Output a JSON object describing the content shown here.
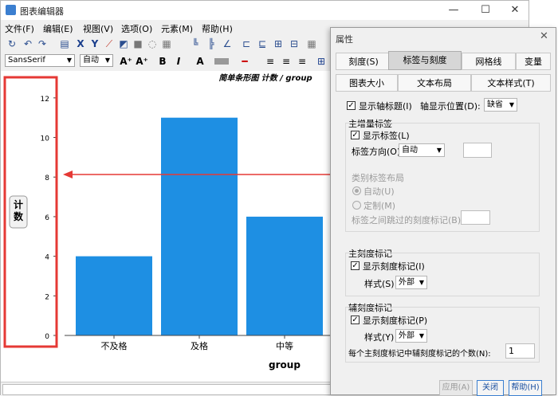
{
  "window": {
    "title": "图表编辑器",
    "minimize": "—",
    "maximize": "☐",
    "close": "✕"
  },
  "menu": [
    "文件(F)",
    "编辑(E)",
    "视图(V)",
    "选项(O)",
    "元素(M)",
    "帮助(H)"
  ],
  "format_bar": {
    "font": "SansSerif",
    "size": "自动",
    "bold": "B",
    "italic": "I"
  },
  "chart_data": {
    "type": "bar",
    "title": "简单条形图 计数 / group",
    "categories": [
      "不及格",
      "及格",
      "中等"
    ],
    "values": [
      4,
      11,
      6
    ],
    "xlabel": "group",
    "ylabel": "计数",
    "ylim": [
      0,
      13
    ],
    "yticks": [
      0,
      2,
      4,
      6,
      8,
      10,
      12
    ],
    "color": "#1e8fe3",
    "grid": false,
    "annotation_color": "#e53935"
  },
  "dialog": {
    "title": "属性",
    "close": "✕",
    "tabs": [
      "刻度(S)",
      "标签与刻度",
      "网格线",
      "变量",
      "图表大小",
      "文本布局",
      "文本样式(T)"
    ],
    "show_axis_title": "显示轴标题(I)",
    "axis_position_label": "轴显示位置(D):",
    "axis_position_value": "缺省",
    "major_labels": {
      "group_title": "主增量标签",
      "show_labels": "显示标签(L)",
      "orientation_label": "标签方向(O)",
      "orientation_value": "自动"
    },
    "category_layout": {
      "title": "类别标签布局",
      "auto": "自动(U)",
      "custom": "定制(M)",
      "skip_label": "标签之间跳过的刻度标记(B)"
    },
    "major_ticks": {
      "title": "主刻度标记",
      "show": "显示刻度标记(I)",
      "style_label": "样式(S)",
      "style_value": "外部"
    },
    "minor_ticks": {
      "title": "辅刻度标记",
      "show": "显示刻度标记(P)",
      "style_label": "样式(Y)",
      "style_value": "外部",
      "count_label": "每个主刻度标记中辅刻度标记的个数(N):",
      "count_value": "1"
    },
    "buttons": {
      "apply": "应用(A)",
      "close": "关闭",
      "help": "帮助(H)"
    }
  }
}
